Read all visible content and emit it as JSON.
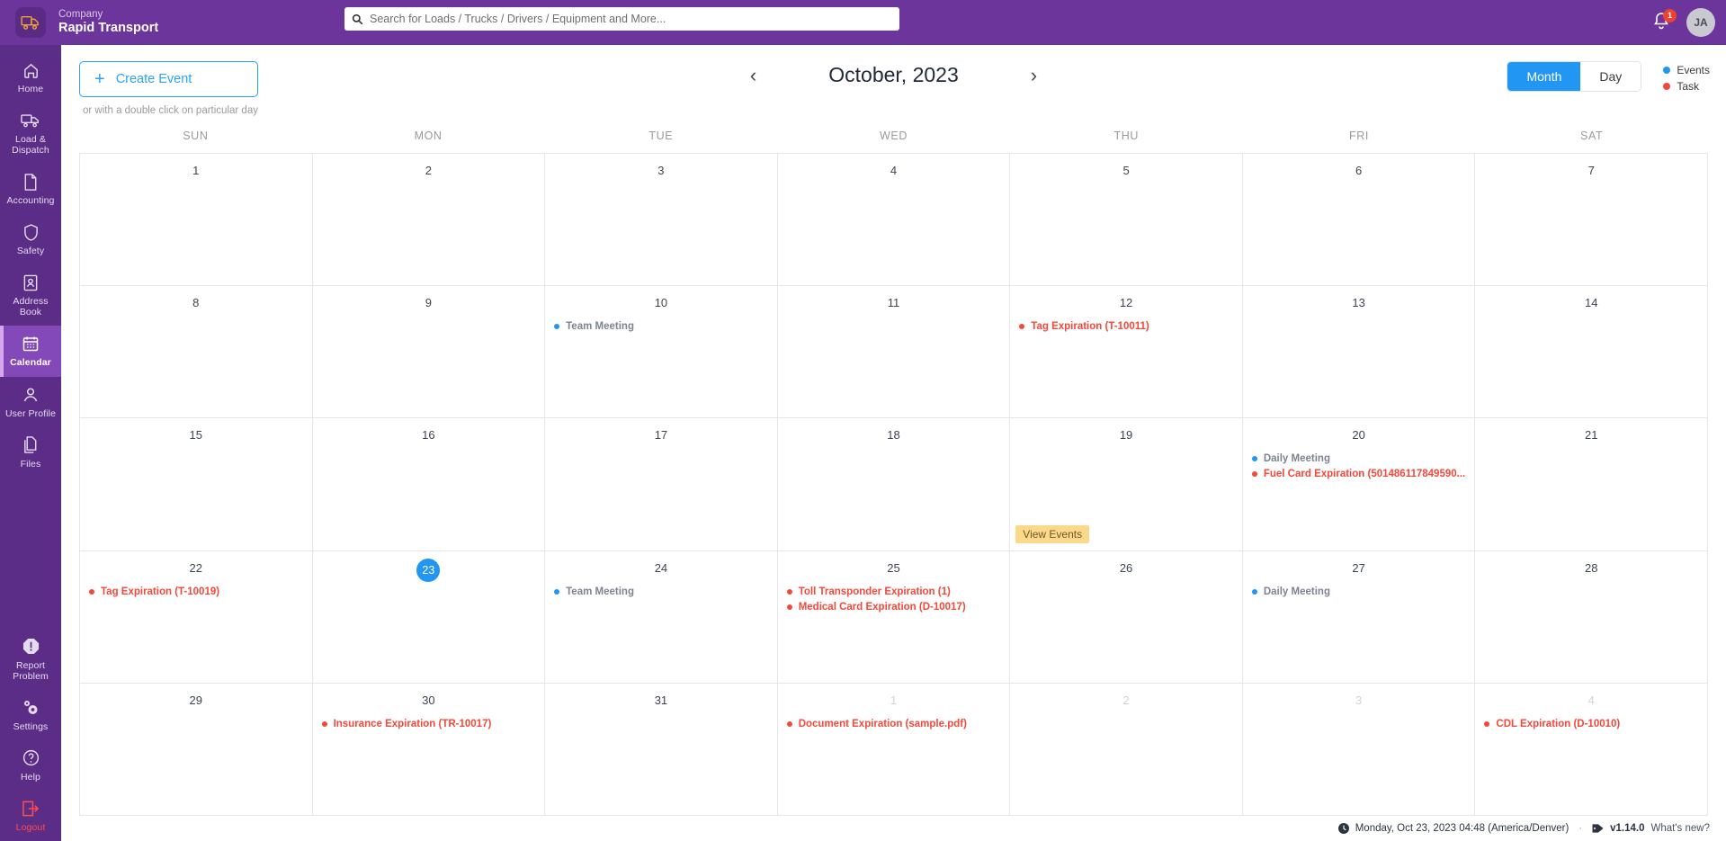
{
  "header": {
    "company_label": "Company",
    "company_name": "Rapid Transport",
    "logo_icon": "truck-icon",
    "search": {
      "icon": "search-icon",
      "placeholder": "Search for Loads / Trucks / Drivers / Equipment and More...",
      "value": ""
    },
    "notifications": {
      "icon": "bell-icon",
      "count": "1"
    },
    "avatar_initials": "JA"
  },
  "sidebar": {
    "items": [
      {
        "label": "Home",
        "icon": "home-icon",
        "active": false
      },
      {
        "label": "Load &\nDispatch",
        "icon": "truck-icon",
        "active": false
      },
      {
        "label": "Accounting",
        "icon": "document-icon",
        "active": false
      },
      {
        "label": "Safety",
        "icon": "shield-icon",
        "active": false
      },
      {
        "label": "Address\nBook",
        "icon": "address-book-icon",
        "active": false
      },
      {
        "label": "Calendar",
        "icon": "calendar-icon",
        "active": true
      },
      {
        "label": "User Profile",
        "icon": "user-icon",
        "active": false
      },
      {
        "label": "Files",
        "icon": "files-icon",
        "active": false
      }
    ],
    "bottom_items": [
      {
        "label": "Report\nProblem",
        "icon": "alert-icon"
      },
      {
        "label": "Settings",
        "icon": "gear-icon"
      },
      {
        "label": "Help",
        "icon": "question-circle-icon"
      },
      {
        "label": "Logout",
        "icon": "logout-icon"
      }
    ]
  },
  "toolbar": {
    "create_label": "Create Event",
    "create_icon": "plus-icon",
    "create_hint": "or with a double click on particular day",
    "prev_icon": "chevron-left-icon",
    "next_icon": "chevron-right-icon",
    "month_title": "October, 2023",
    "views": [
      {
        "label": "Month",
        "selected": true
      },
      {
        "label": "Day",
        "selected": false
      }
    ],
    "legend": [
      {
        "label": "Events",
        "color": "#2196f3"
      },
      {
        "label": "Task",
        "color": "#f4483a"
      }
    ]
  },
  "calendar": {
    "weekdays": [
      "SUN",
      "MON",
      "TUE",
      "WED",
      "THU",
      "FRI",
      "SAT"
    ],
    "weeks": [
      [
        {
          "day": "1",
          "other": false,
          "events": []
        },
        {
          "day": "2",
          "other": false,
          "events": []
        },
        {
          "day": "3",
          "other": false,
          "events": []
        },
        {
          "day": "4",
          "other": false,
          "events": []
        },
        {
          "day": "5",
          "other": false,
          "events": []
        },
        {
          "day": "6",
          "other": false,
          "events": []
        },
        {
          "day": "7",
          "other": false,
          "events": []
        }
      ],
      [
        {
          "day": "8",
          "other": false,
          "events": []
        },
        {
          "day": "9",
          "other": false,
          "events": []
        },
        {
          "day": "10",
          "other": false,
          "events": [
            {
              "label": "Team Meeting",
              "type": "event"
            }
          ]
        },
        {
          "day": "11",
          "other": false,
          "events": []
        },
        {
          "day": "12",
          "other": false,
          "events": [
            {
              "label": "Tag Expiration (T-10011)",
              "type": "task"
            }
          ]
        },
        {
          "day": "13",
          "other": false,
          "events": []
        },
        {
          "day": "14",
          "other": false,
          "events": []
        }
      ],
      [
        {
          "day": "15",
          "other": false,
          "events": []
        },
        {
          "day": "16",
          "other": false,
          "events": []
        },
        {
          "day": "17",
          "other": false,
          "events": []
        },
        {
          "day": "18",
          "other": false,
          "events": []
        },
        {
          "day": "19",
          "other": false,
          "events": [],
          "view_events": "View Events"
        },
        {
          "day": "20",
          "other": false,
          "events": [
            {
              "label": "Daily Meeting",
              "type": "event"
            },
            {
              "label": "Fuel Card Expiration (501486117849590...",
              "type": "task"
            }
          ]
        },
        {
          "day": "21",
          "other": false,
          "events": []
        }
      ],
      [
        {
          "day": "22",
          "other": false,
          "events": [
            {
              "label": "Tag Expiration (T-10019)",
              "type": "task"
            }
          ]
        },
        {
          "day": "23",
          "other": false,
          "today": true,
          "events": []
        },
        {
          "day": "24",
          "other": false,
          "events": [
            {
              "label": "Team Meeting",
              "type": "event"
            }
          ]
        },
        {
          "day": "25",
          "other": false,
          "events": [
            {
              "label": "Toll Transponder Expiration (1)",
              "type": "task"
            },
            {
              "label": "Medical Card Expiration (D-10017)",
              "type": "task"
            }
          ]
        },
        {
          "day": "26",
          "other": false,
          "events": []
        },
        {
          "day": "27",
          "other": false,
          "events": [
            {
              "label": "Daily Meeting",
              "type": "event"
            }
          ]
        },
        {
          "day": "28",
          "other": false,
          "events": []
        }
      ],
      [
        {
          "day": "29",
          "other": false,
          "events": []
        },
        {
          "day": "30",
          "other": false,
          "events": [
            {
              "label": "Insurance Expiration (TR-10017)",
              "type": "task"
            }
          ]
        },
        {
          "day": "31",
          "other": false,
          "events": []
        },
        {
          "day": "1",
          "other": true,
          "events": [
            {
              "label": "Document Expiration (sample.pdf)",
              "type": "task"
            }
          ]
        },
        {
          "day": "2",
          "other": true,
          "events": []
        },
        {
          "day": "3",
          "other": true,
          "events": []
        },
        {
          "day": "4",
          "other": true,
          "events": [
            {
              "label": "CDL Expiration (D-10010)",
              "type": "task"
            }
          ]
        }
      ]
    ]
  },
  "footer": {
    "clock_icon": "clock-icon",
    "datetime": "Monday, Oct 23, 2023 04:48 (America/Denver)",
    "separator": "·",
    "tag_icon": "tag-icon",
    "version": "v1.14.0",
    "whats_new": "What's new?"
  }
}
